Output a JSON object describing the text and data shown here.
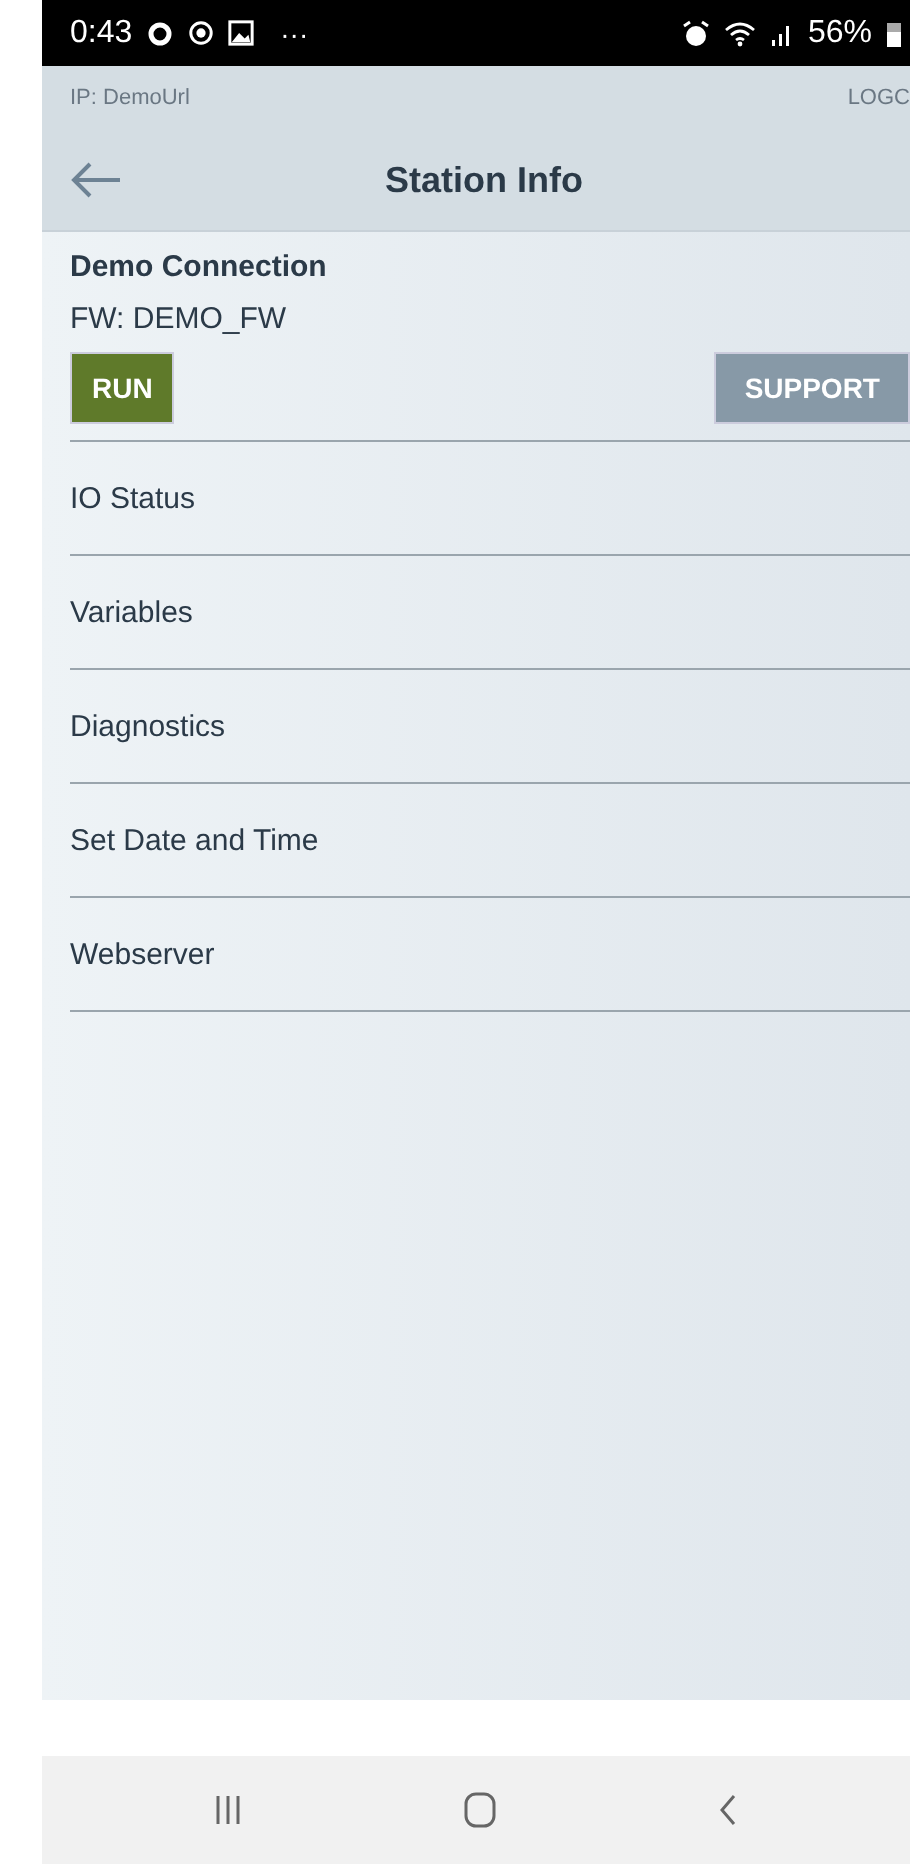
{
  "status_bar": {
    "time": "0:43",
    "more": "···",
    "battery": "56%"
  },
  "top_bar": {
    "ip": "IP: DemoUrl",
    "logo": "LOGC"
  },
  "header": {
    "title": "Station Info"
  },
  "station": {
    "name": "Demo Connection",
    "firmware": "FW: DEMO_FW"
  },
  "buttons": [
    {
      "label": "RUN",
      "kind": "run"
    },
    {
      "label": "SUPPORT",
      "kind": "support"
    }
  ],
  "menu": [
    "IO Status",
    "Variables",
    "Diagnostics",
    "Set Date and Time",
    "Webserver"
  ]
}
